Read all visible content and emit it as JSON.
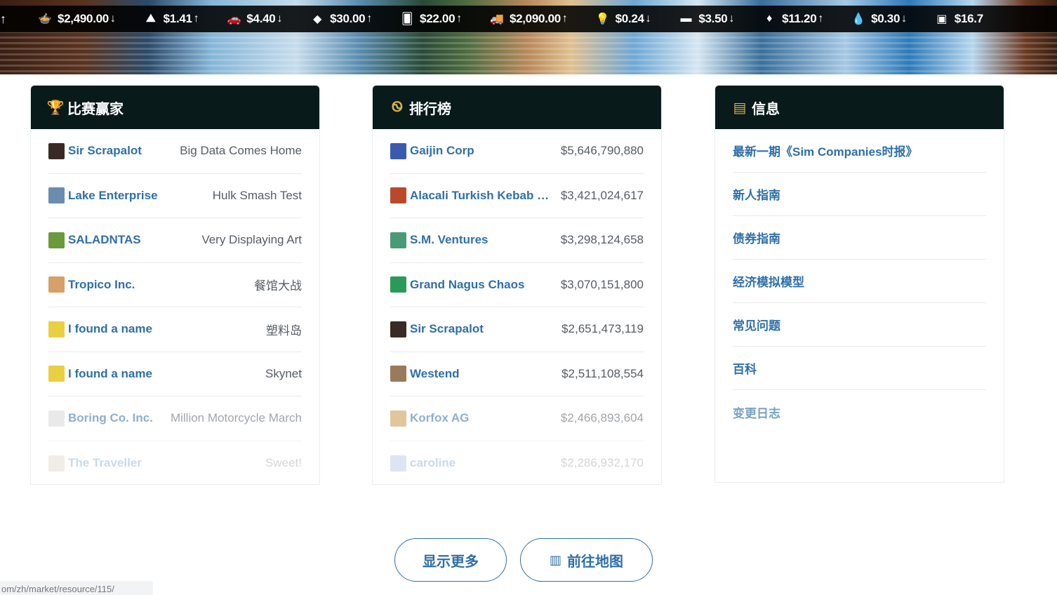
{
  "ticker": {
    "lead_arrow": "↑",
    "items": [
      {
        "icon": "food-bowl-icon",
        "glyph": "🍲",
        "price": "$2,490.00",
        "dir": "↓"
      },
      {
        "icon": "ore-pile-icon",
        "glyph": "⛰",
        "price": "$1.41",
        "dir": "↑"
      },
      {
        "icon": "car-icon",
        "glyph": "🚗",
        "price": "$4.40",
        "dir": "↓"
      },
      {
        "icon": "gold-nugget-icon",
        "glyph": "◆",
        "price": "$30.00",
        "dir": "↑"
      },
      {
        "icon": "card-icon",
        "glyph": "🂠",
        "price": "$22.00",
        "dir": "↑"
      },
      {
        "icon": "truck-icon",
        "glyph": "🚚",
        "price": "$2,090.00",
        "dir": "↑"
      },
      {
        "icon": "lightbulb-icon",
        "glyph": "💡",
        "price": "$0.24",
        "dir": "↓"
      },
      {
        "icon": "plank-icon",
        "glyph": "▬",
        "price": "$3.50",
        "dir": "↓"
      },
      {
        "icon": "crystal-icon",
        "glyph": "♦",
        "price": "$11.20",
        "dir": "↑"
      },
      {
        "icon": "water-drop-icon",
        "glyph": "💧",
        "price": "$0.30",
        "dir": "↓"
      },
      {
        "icon": "cash-stack-icon",
        "glyph": "▣",
        "price": "$16.7",
        "dir": ""
      }
    ]
  },
  "contest": {
    "title": "比赛赢家",
    "icon": "trophy-icon",
    "rows": [
      {
        "name": "Sir Scrapalot",
        "value": "Big Data Comes Home",
        "avatar_color": "#3a2a24"
      },
      {
        "name": "Lake Enterprise",
        "value": "Hulk Smash Test",
        "avatar_color": "#6a8cae"
      },
      {
        "name": "SALADNTAS",
        "value": "Very Displaying Art",
        "avatar_color": "#6a9a3a"
      },
      {
        "name": "Tropico Inc.",
        "value": "餐馆大战",
        "avatar_color": "#d6a068"
      },
      {
        "name": "I found a name",
        "value": "塑料岛",
        "avatar_color": "#e8d040"
      },
      {
        "name": "I found a name",
        "value": "Skynet",
        "avatar_color": "#e8d040"
      },
      {
        "name": "Boring Co. Inc.",
        "value": "Million Motorcycle March",
        "avatar_color": "#d8d8d8"
      },
      {
        "name": "The Traveller",
        "value": "Sweet!",
        "avatar_color": "#c8b8a0"
      }
    ]
  },
  "ranking": {
    "title": "排行榜",
    "icon": "medal-icon",
    "rows": [
      {
        "name": "Gaijin Corp",
        "value": "$5,646,790,880",
        "avatar_color": "#3a5ab0"
      },
      {
        "name": "Alacali Turkish Kebab Ho...",
        "value": "$3,421,024,617",
        "avatar_color": "#b84a2a"
      },
      {
        "name": "S.M. Ventures",
        "value": "$3,298,124,658",
        "avatar_color": "#4a9a7a"
      },
      {
        "name": "Grand Nagus Chaos",
        "value": "$3,070,151,800",
        "avatar_color": "#2a9a5a"
      },
      {
        "name": "Sir Scrapalot",
        "value": "$2,651,473,119",
        "avatar_color": "#3a2a24"
      },
      {
        "name": "Westend",
        "value": "$2,511,108,554",
        "avatar_color": "#9a7a5a"
      },
      {
        "name": "Korfox AG",
        "value": "$2,466,893,604",
        "avatar_color": "#c89a4a"
      },
      {
        "name": "caroline",
        "value": "$2,286,932,170",
        "avatar_color": "#7a9ac8"
      }
    ]
  },
  "info": {
    "title": "信息",
    "icon": "newspaper-icon",
    "links": [
      "最新一期《Sim Companies时报》",
      "新人指南",
      "债券指南",
      "经济模拟模型",
      "常见问题",
      "百科",
      "变更日志"
    ]
  },
  "buttons": {
    "show_more": "显示更多",
    "go_map": "前往地图"
  },
  "status_bar": {
    "url": "om/zh/market/resource/115/"
  },
  "colors": {
    "accent": "#2f6fa8",
    "header_bg": "#081a1a",
    "icon_gold": "#d8b24a"
  }
}
